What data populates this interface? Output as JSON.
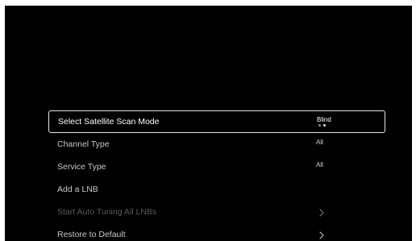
{
  "menu": {
    "items": [
      {
        "label": "Select Satellite Scan Mode",
        "value": "Blind",
        "state": "focused",
        "control": "selector",
        "selected_index": 0,
        "option_count": 2
      },
      {
        "label": "Channel Type",
        "value": "All",
        "state": "normal",
        "control": "value"
      },
      {
        "label": "Service Type",
        "value": "All",
        "state": "normal",
        "control": "value"
      },
      {
        "label": "Add a LNB",
        "value": "",
        "state": "normal",
        "control": "none"
      },
      {
        "label": "Start Auto Tuning All LNBs",
        "value": "",
        "state": "disabled",
        "control": "chevron-right-icon"
      },
      {
        "label": "Restore to Default",
        "value": "",
        "state": "normal",
        "control": "chevron-right-icon"
      }
    ]
  },
  "colors": {
    "background": "#000000",
    "focus_border": "#e6e6e6",
    "selector_dot_active": "#3ba3e6",
    "selector_dot_inactive": "#e6e6e6",
    "text_disabled": "#5a5a5a"
  }
}
